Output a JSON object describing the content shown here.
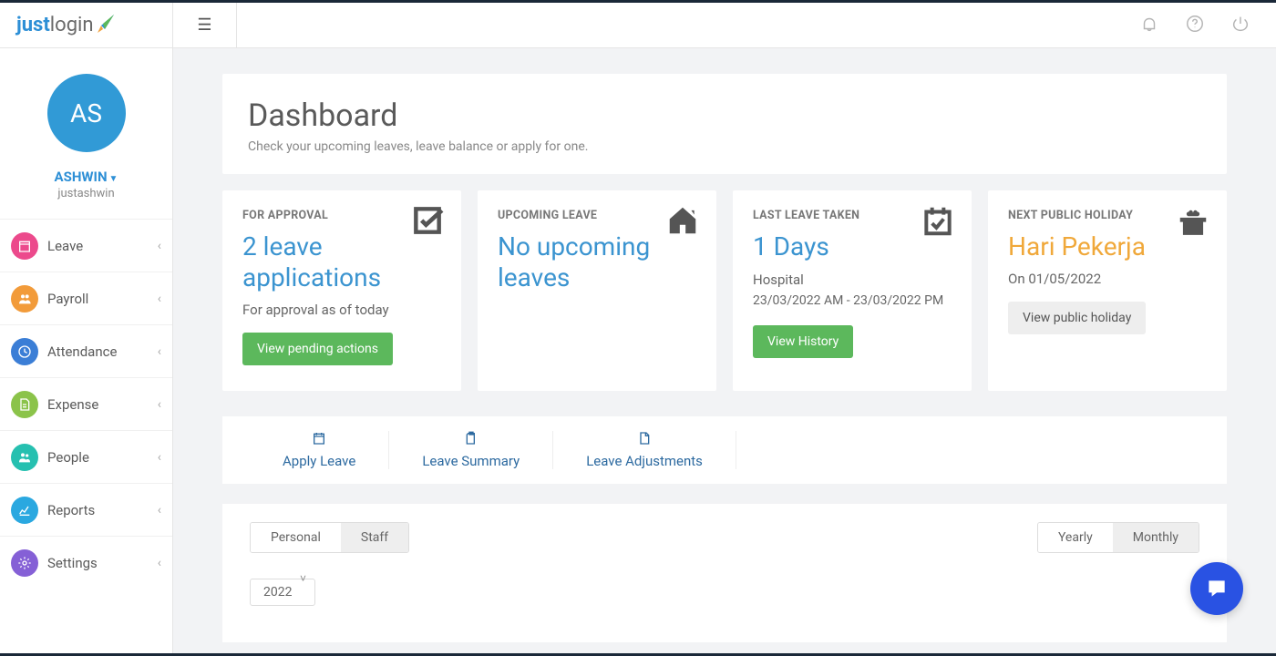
{
  "brand": {
    "part1": "just",
    "part2": "login"
  },
  "user": {
    "initials": "AS",
    "name": "ASHWIN",
    "handle": "justashwin"
  },
  "sidebar": {
    "items": [
      {
        "label": "Leave",
        "color": "#ec4a8c"
      },
      {
        "label": "Payroll",
        "color": "#f29b3a"
      },
      {
        "label": "Attendance",
        "color": "#3b7ed6"
      },
      {
        "label": "Expense",
        "color": "#8bc34a"
      },
      {
        "label": "People",
        "color": "#26c0b0"
      },
      {
        "label": "Reports",
        "color": "#2aa8e0"
      },
      {
        "label": "Settings",
        "color": "#8560d6"
      }
    ]
  },
  "header": {
    "title": "Dashboard",
    "subtitle": "Check your upcoming leaves, leave balance or apply for one."
  },
  "cards": {
    "approval": {
      "label": "FOR APPROVAL",
      "value": "2 leave applications",
      "sub": "For approval as of today",
      "cta": "View pending actions"
    },
    "upcoming": {
      "label": "UPCOMING LEAVE",
      "value": "No upcoming leaves"
    },
    "last": {
      "label": "LAST LEAVE TAKEN",
      "value": "1 Days",
      "type": "Hospital",
      "range": "23/03/2022 AM - 23/03/2022 PM",
      "cta": "View History"
    },
    "holiday": {
      "label": "NEXT PUBLIC HOLIDAY",
      "value": "Hari Pekerja",
      "date": "On 01/05/2022",
      "cta": "View public holiday"
    }
  },
  "actions": [
    {
      "label": "Apply Leave"
    },
    {
      "label": "Leave Summary"
    },
    {
      "label": "Leave Adjustments"
    }
  ],
  "filters": {
    "scope": {
      "options": [
        "Personal",
        "Staff"
      ],
      "active": "Personal"
    },
    "period": {
      "options": [
        "Yearly",
        "Monthly"
      ],
      "active": "Yearly"
    },
    "year": "2022"
  }
}
